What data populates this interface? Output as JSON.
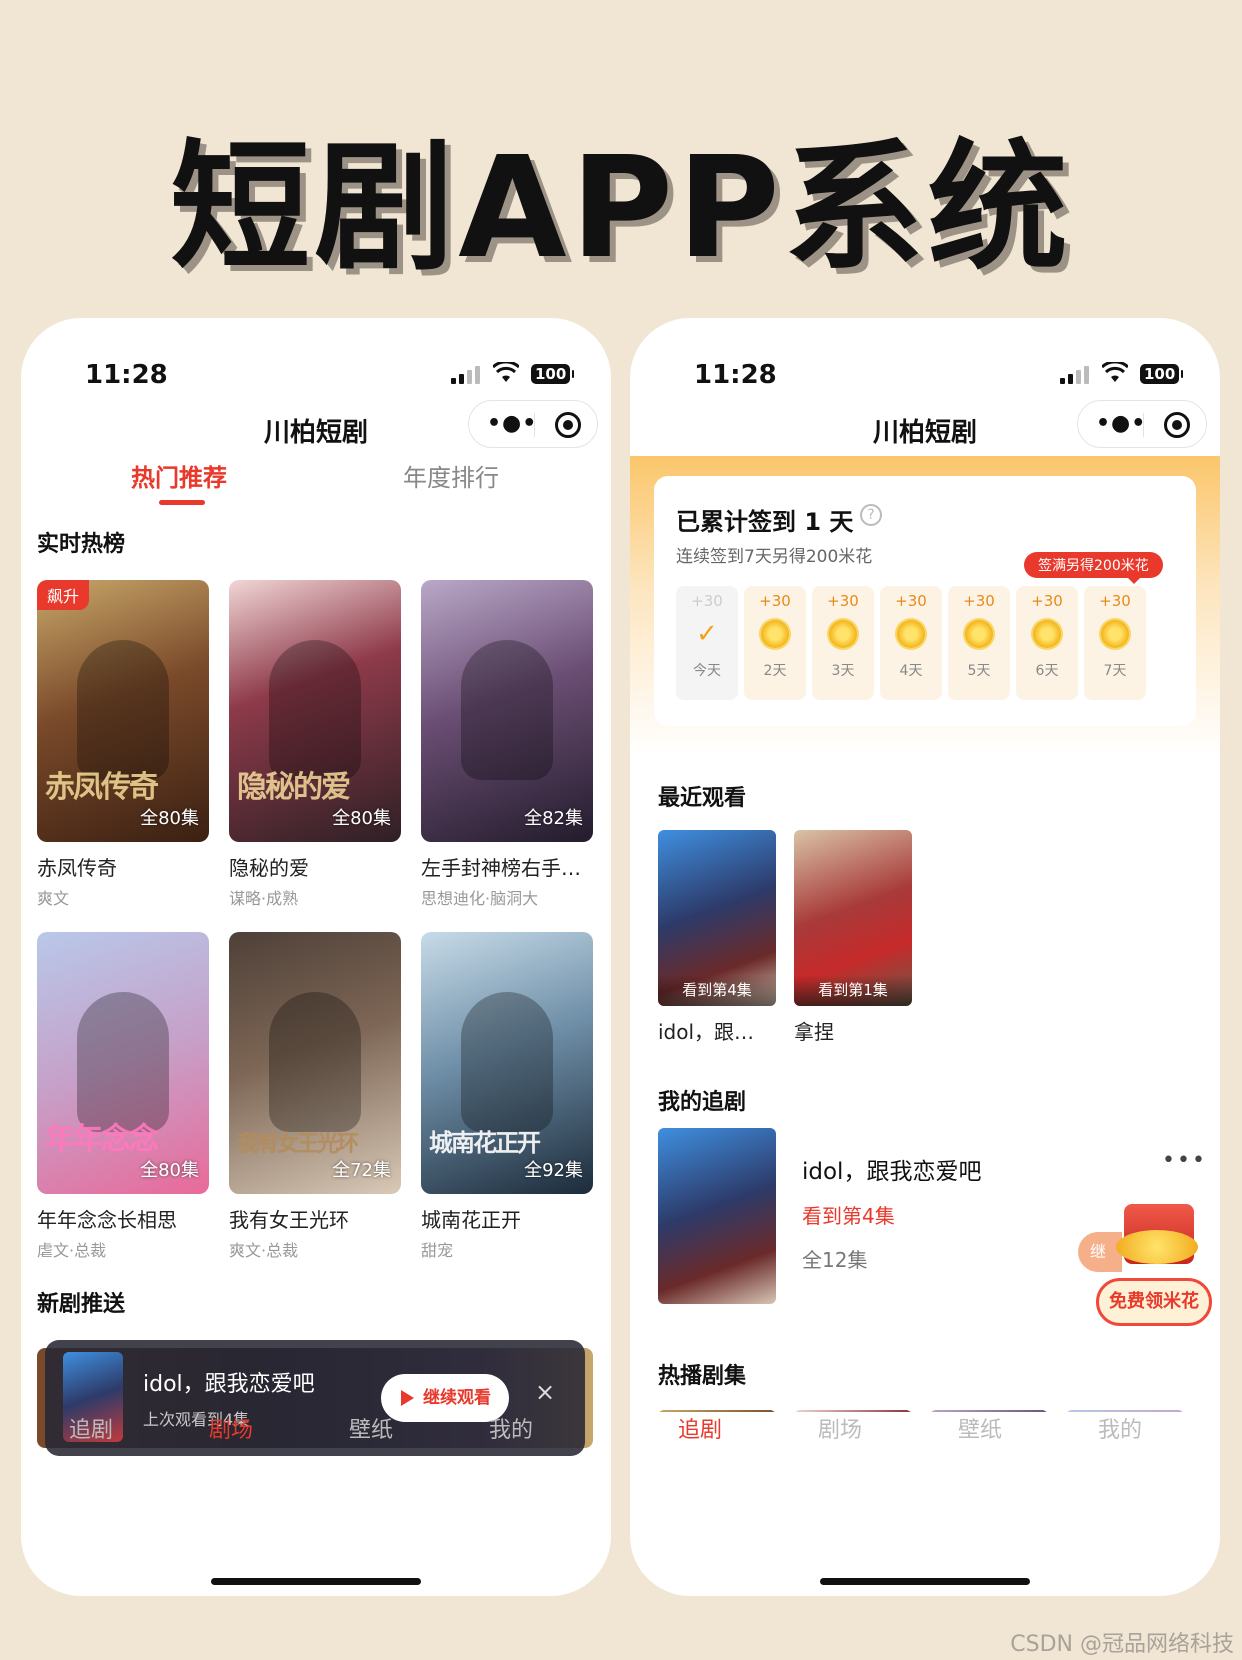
{
  "headline": "短剧APP系统",
  "watermark": "CSDN @冠品网络科技",
  "status": {
    "time": "11:28",
    "battery": "100"
  },
  "app_title": "川柏短剧",
  "left": {
    "tabs": [
      "热门推荐",
      "年度排行"
    ],
    "realtime_title": "实时热榜",
    "badge": "飙升",
    "cards": [
      {
        "name": "赤凤传奇",
        "tags": "爽文",
        "episodes": "全80集",
        "poster_text": "赤凤传奇"
      },
      {
        "name": "隐秘的爱",
        "tags": "谋略·成熟",
        "episodes": "全80集",
        "poster_text": "隐秘的爱"
      },
      {
        "name": "左手封神榜右手…",
        "tags": "思想迪化·脑洞大",
        "episodes": "全82集",
        "poster_text": ""
      },
      {
        "name": "年年念念长相思",
        "tags": "虐文·总裁",
        "episodes": "全80集",
        "poster_text": "年年念念"
      },
      {
        "name": "我有女王光环",
        "tags": "爽文·总裁",
        "episodes": "全72集",
        "poster_text": "我有女王光环"
      },
      {
        "name": "城南花正开",
        "tags": "甜宠",
        "episodes": "全92集",
        "poster_text": "城南花正开"
      }
    ],
    "new_push_title": "新剧推送",
    "push": {
      "title": "idol，跟我恋爱吧",
      "subtitle": "上次观看到4集",
      "button": "继续观看",
      "close": "×"
    },
    "nav": [
      "追剧",
      "剧场",
      "壁纸",
      "我的"
    ],
    "active_nav": 1
  },
  "right": {
    "sign": {
      "title": "已累计签到 1 天",
      "help": "?",
      "subtitle": "连续签到7天另得200米花",
      "bonus": "签满另得200米花",
      "days": [
        {
          "points": "+30",
          "label": "今天",
          "done": true
        },
        {
          "points": "+30",
          "label": "2天",
          "done": false
        },
        {
          "points": "+30",
          "label": "3天",
          "done": false
        },
        {
          "points": "+30",
          "label": "4天",
          "done": false
        },
        {
          "points": "+30",
          "label": "5天",
          "done": false
        },
        {
          "points": "+30",
          "label": "6天",
          "done": false
        },
        {
          "points": "+30",
          "label": "7天",
          "done": false
        }
      ]
    },
    "recent_title": "最近观看",
    "recent": [
      {
        "name": "idol，跟…",
        "progress": "看到第4集"
      },
      {
        "name": "拿捏",
        "progress": "看到第1集"
      }
    ],
    "follow_title": "我的追剧",
    "follow": {
      "title": "idol，跟我恋爱吧",
      "watched": "看到第4集",
      "episodes": "全12集",
      "more": "•••"
    },
    "promo": {
      "tag": "继",
      "label": "免费领米花"
    },
    "hot_title": "热播剧集",
    "nav": [
      "追剧",
      "剧场",
      "壁纸",
      "我的"
    ],
    "active_nav": 0
  }
}
